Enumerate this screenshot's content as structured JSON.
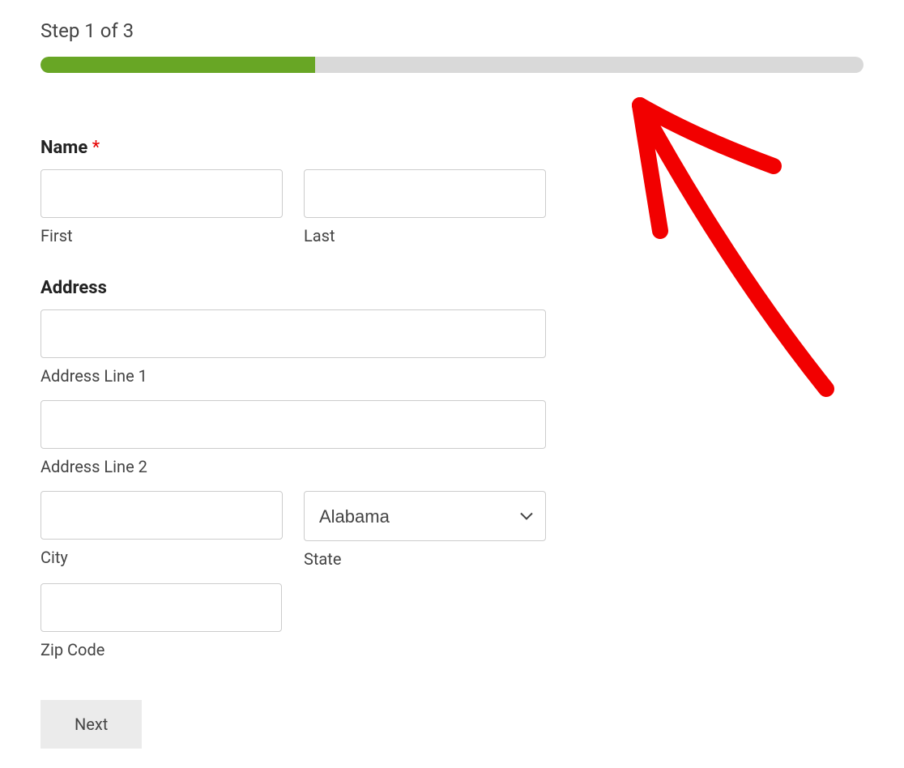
{
  "step": {
    "label": "Step 1 of 3",
    "progress_percent": 33.333
  },
  "form": {
    "name": {
      "label": "Name",
      "required_marker": "*",
      "first_sublabel": "First",
      "last_sublabel": "Last",
      "first_value": "",
      "last_value": ""
    },
    "address": {
      "label": "Address",
      "line1_sublabel": "Address Line 1",
      "line2_sublabel": "Address Line 2",
      "city_sublabel": "City",
      "state_sublabel": "State",
      "zip_sublabel": "Zip Code",
      "line1_value": "",
      "line2_value": "",
      "city_value": "",
      "state_selected": "Alabama",
      "zip_value": ""
    },
    "next_button": "Next"
  },
  "colors": {
    "progress_fill": "#68a625",
    "progress_bg": "#d9d9d9",
    "required": "#e60000",
    "annotation": "#f20000"
  }
}
